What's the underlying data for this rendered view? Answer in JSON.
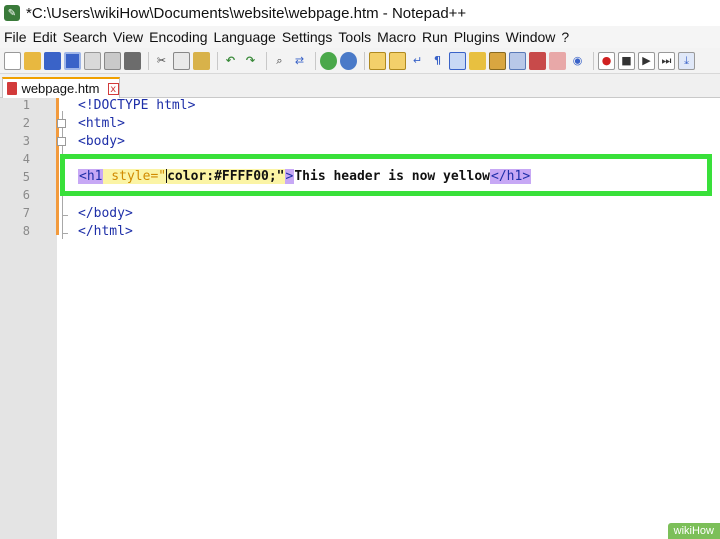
{
  "window": {
    "title": "*C:\\Users\\wikiHow\\Documents\\website\\webpage.htm - Notepad++"
  },
  "menu": [
    "File",
    "Edit",
    "Search",
    "View",
    "Encoding",
    "Language",
    "Settings",
    "Tools",
    "Macro",
    "Run",
    "Plugins",
    "Window",
    "?"
  ],
  "tab": {
    "label": "webpage.htm",
    "close": "x"
  },
  "editor": {
    "line_numbers": [
      "1",
      "2",
      "3",
      "4",
      "5",
      "6",
      "7",
      "8"
    ],
    "lines": {
      "l1": "<!DOCTYPE html>",
      "l2": "<html>",
      "l3": "<body>",
      "l7": "</body>",
      "l8": "</html>"
    },
    "line5": {
      "open_tag": "<h1",
      "attr": " style=\"",
      "value": "color:#FFFF00;\"",
      "close_bracket": ">",
      "text": "This header is now yellow",
      "end_tag": "</h1>"
    }
  },
  "colors": {
    "highlight_box": "#39e03a",
    "change_bar": "#f29a3c",
    "tag_bg": "#c7a8f5"
  },
  "watermark": "wikiHow"
}
